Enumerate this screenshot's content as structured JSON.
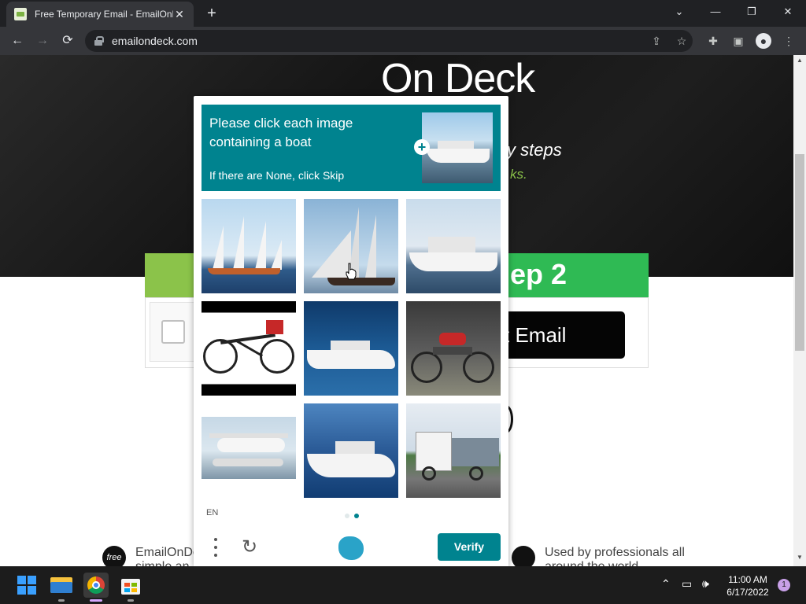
{
  "browser": {
    "tab_title": "Free Temporary Email - EmailOnD",
    "url": "emailondeck.com",
    "new_tab_icon": "plus-icon",
    "window_controls": [
      "chevron-down-icon",
      "minimize-icon",
      "restore-icon",
      "close-icon"
    ]
  },
  "page": {
    "brand": "On Deck",
    "tagline": "y steps",
    "tagline2": "ks.",
    "step2_label": "ep 2",
    "get_email_label": "t Email",
    "footer_badge": "free",
    "footer_left_line1": "EmailOnDe",
    "footer_left_line2": "simple an",
    "footer_right_line1": "Used by professionals all",
    "footer_right_line2": "around the world"
  },
  "captcha": {
    "prompt": "Please click each image containing a boat",
    "skip_hint": "If there are None, click Skip",
    "language": "EN",
    "verify_label": "Verify",
    "page_indicator": {
      "total": 2,
      "current": 2
    },
    "tiles": [
      {
        "subject": "sailboat"
      },
      {
        "subject": "sailboat"
      },
      {
        "subject": "yacht"
      },
      {
        "subject": "bicycle"
      },
      {
        "subject": "yacht"
      },
      {
        "subject": "motorcycle"
      },
      {
        "subject": "seaplane"
      },
      {
        "subject": "yacht"
      },
      {
        "subject": "truck"
      }
    ]
  },
  "taskbar": {
    "apps": [
      "windows-start-icon",
      "file-explorer-icon",
      "chrome-icon",
      "microsoft-store-icon"
    ],
    "time": "11:00 AM",
    "date": "6/17/2022",
    "notification_count": "1"
  }
}
